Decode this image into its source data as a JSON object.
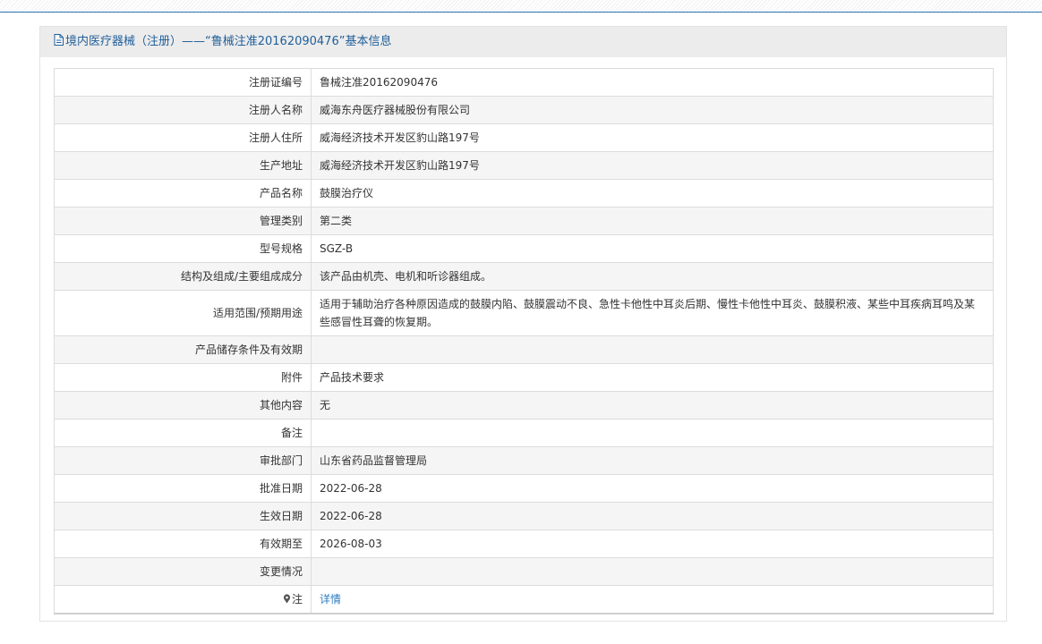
{
  "header": {
    "title": "境内医疗器械（注册）——“鲁械注准20162090476”基本信息"
  },
  "rows": [
    {
      "label": "注册证编号",
      "value": "鲁械注准20162090476"
    },
    {
      "label": "注册人名称",
      "value": "威海东舟医疗器械股份有限公司"
    },
    {
      "label": "注册人住所",
      "value": "威海经济技术开发区豹山路197号"
    },
    {
      "label": "生产地址",
      "value": "威海经济技术开发区豹山路197号"
    },
    {
      "label": "产品名称",
      "value": "鼓膜治疗仪"
    },
    {
      "label": "管理类别",
      "value": "第二类"
    },
    {
      "label": "型号规格",
      "value": "SGZ-B"
    },
    {
      "label": "结构及组成/主要组成成分",
      "value": "该产品由机壳、电机和听诊器组成。"
    },
    {
      "label": "适用范围/预期用途",
      "value": "适用于辅助治疗各种原因造成的鼓膜内陷、鼓膜震动不良、急性卡他性中耳炎后期、慢性卡他性中耳炎、鼓膜积液、某些中耳疾病耳鸣及某些感冒性耳聋的恢复期。"
    },
    {
      "label": "产品储存条件及有效期",
      "value": ""
    },
    {
      "label": "附件",
      "value": "产品技术要求"
    },
    {
      "label": "其他内容",
      "value": "无"
    },
    {
      "label": "备注",
      "value": ""
    },
    {
      "label": "审批部门",
      "value": "山东省药品监督管理局"
    },
    {
      "label": "批准日期",
      "value": "2022-06-28"
    },
    {
      "label": "生效日期",
      "value": "2022-06-28"
    },
    {
      "label": "有效期至",
      "value": "2026-08-03"
    },
    {
      "label": "变更情况",
      "value": ""
    },
    {
      "label": "注",
      "value": "详情"
    }
  ],
  "icons": {
    "header": "document-icon",
    "note": "pin-icon"
  }
}
